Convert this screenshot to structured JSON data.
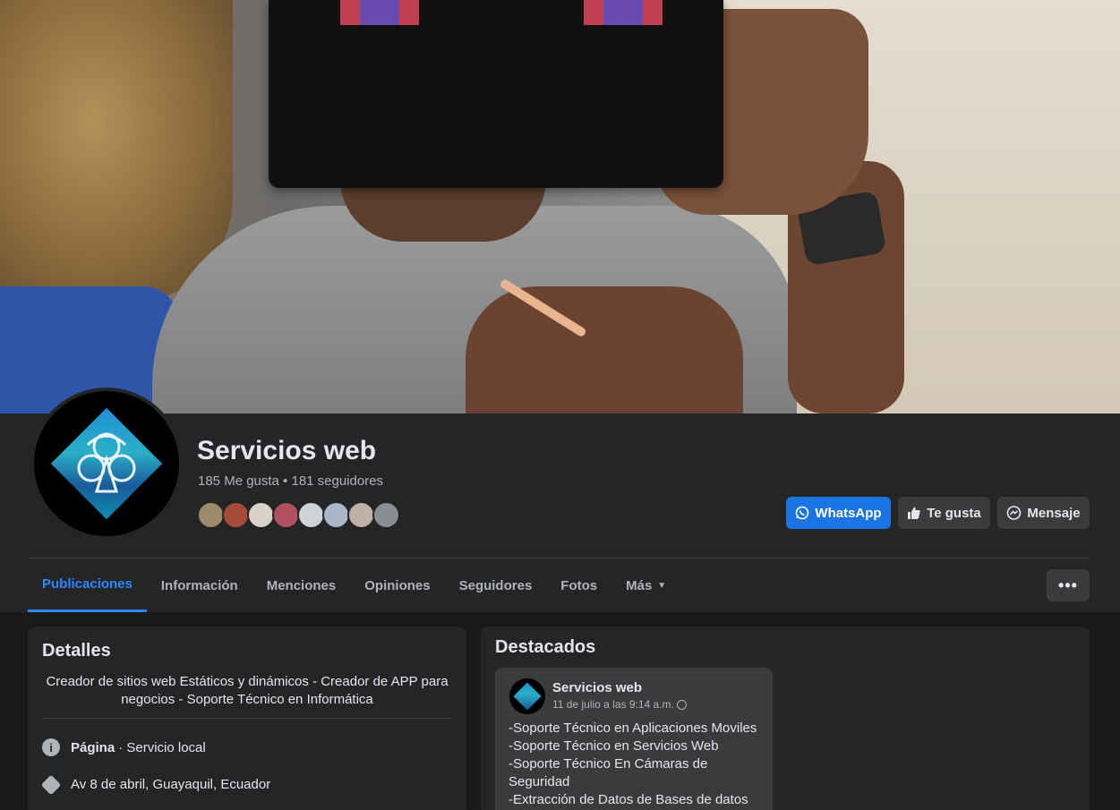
{
  "page": {
    "title": "Servicios web",
    "stats": "185 Me gusta • 181 seguidores",
    "follower_faces": [
      "#9a8b6a",
      "#a84a3a",
      "#d8d2c8",
      "#b05060",
      "#cfd2d6",
      "#a9b6c8",
      "#c0b0a6",
      "#8a8d91"
    ]
  },
  "actions": {
    "whatsapp": "WhatsApp",
    "like": "Te gusta",
    "message": "Mensaje",
    "more": "•••"
  },
  "tabs": [
    {
      "label": "Publicaciones",
      "active": true
    },
    {
      "label": "Información"
    },
    {
      "label": "Menciones"
    },
    {
      "label": "Opiniones"
    },
    {
      "label": "Seguidores"
    },
    {
      "label": "Fotos"
    },
    {
      "label": "Más"
    }
  ],
  "details": {
    "heading": "Detalles",
    "bio": "Creador de sitios web Estáticos y dinámicos - Creador de APP para negocios - Soporte Técnico en Informática",
    "category_label": "Página",
    "category_value": "· Servicio local",
    "address": "Av 8 de abril, Guayaquil, Ecuador"
  },
  "highlights": {
    "heading": "Destacados",
    "post": {
      "author": "Servicios web",
      "date": "11 de julio a las 9:14 a.m.",
      "lines": [
        "-Soporte Técnico en Aplicaciones Moviles",
        "-Soporte Técnico en Servicios Web",
        "-Soporte Técnico En Cámaras de Seguridad",
        "-Extracción de Datos de Bases de datos"
      ]
    }
  },
  "colors": {
    "accent": "#2d88ff",
    "whatsapp_button": "#1b74e4",
    "panel": "#242526",
    "background": "#18191a"
  }
}
